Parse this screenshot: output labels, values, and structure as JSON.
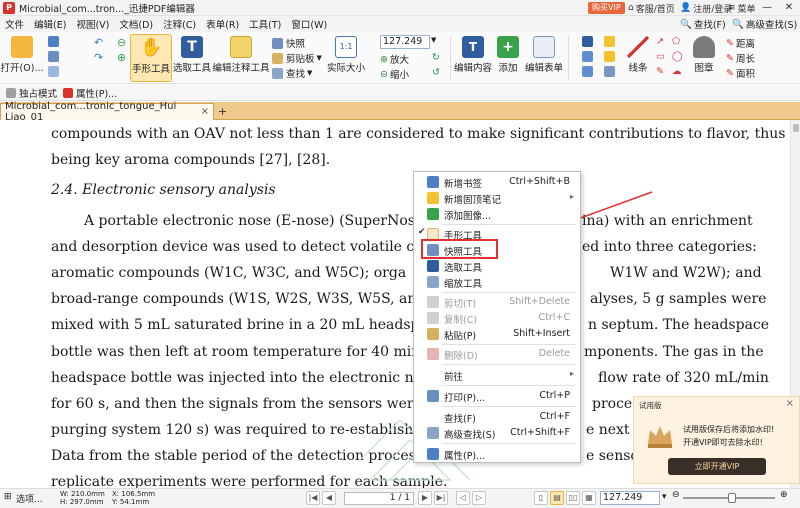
{
  "app": {
    "title": "Microbial_com...tron..._迅捷PDF编辑器",
    "vip_label": "购买VIP",
    "home_label": "客服/首页",
    "login_label": "注册/登录",
    "menu_label": "菜单"
  },
  "menu": {
    "items": [
      "文件",
      "编辑(E)",
      "视图(V)",
      "文档(D)",
      "注释(C)",
      "表单(R)",
      "工具(T)",
      "窗口(W)"
    ],
    "find_label": "查找(F)",
    "advanced_find_label": "高级查找(S)"
  },
  "ribbon": {
    "open": "打开(O)...",
    "hand_tool": "手形工具",
    "select_tool": "选取工具",
    "edit_annot_tool": "编辑注释工具",
    "snapshot": "快照",
    "clipboard": "剪贴板",
    "find": "查找",
    "actual_size": "实际大小",
    "zoom_value": "127.249",
    "zoom_in": "放大",
    "zoom_out": "缩小",
    "edit_content": "编辑内容",
    "add": "添加",
    "edit_form": "编辑表单",
    "line": "线条",
    "stamp": "图章",
    "distance": "距离",
    "perimeter": "周长",
    "area": "面积"
  },
  "toolbar2": {
    "exclusive_mode": "独占模式",
    "properties": "属性(P)..."
  },
  "tab": {
    "name": "Microbial_com...tronic_tongue_Hui Liao_01",
    "close": "×",
    "add": "+"
  },
  "doc": {
    "lines": [
      "compounds with an OAV not less than 1 are considered to make significant contributions to flavor, thus",
      "being key aroma compounds [27], [28].",
      "2.4. Electronic sensory analysis",
      "A portable electronic nose (E-nose) (SuperNose14,",
      "and desorption device was used to detect volatile compo",
      "aromatic compounds (W1C, W3C, and W5C); orga",
      "broad-range compounds (W1S, W2S, W3S, W5S, and W6",
      "mixed with 5 mL saturated brine in a 20 mL headspace",
      "bottle was then left at room temperature for 40 min to e",
      "headspace bottle was injected into the electronic nose via a",
      "for 60 s, and then the signals from the sensors were reco",
      "purging system 120 s) was required to re-establish the ins",
      "Data from the stable period of the detection process (54",
      "replicate experiments were performed for each sample."
    ],
    "right_lines": [
      "ina) with an enrichment",
      "ed into three categories:",
      "W1W and W2W); and",
      "alyses, 5 g samples were",
      "n septum. The headspace",
      "mponents. The gas in the",
      "flow rate of 320 mL/min",
      "proce",
      "e next sa",
      "e sensor"
    ]
  },
  "context_menu": {
    "items": [
      {
        "label": "新增书签",
        "shortcut": "Ctrl+Shift+B",
        "disabled": false
      },
      {
        "label": "新增固顶笔记",
        "shortcut": "",
        "disabled": false,
        "submenu": true
      },
      {
        "label": "添加图像...",
        "shortcut": "",
        "disabled": false
      },
      {
        "label": "手形工具",
        "shortcut": "",
        "disabled": false,
        "checked": true
      },
      {
        "label": "快照工具",
        "shortcut": "",
        "disabled": false
      },
      {
        "label": "选取工具",
        "shortcut": "",
        "disabled": false
      },
      {
        "label": "缩放工具",
        "shortcut": "",
        "disabled": false
      },
      {
        "label": "剪切(T)",
        "shortcut": "Shift+Delete",
        "disabled": true
      },
      {
        "label": "复制(C)",
        "shortcut": "Ctrl+C",
        "disabled": true
      },
      {
        "label": "粘贴(P)",
        "shortcut": "Shift+Insert",
        "disabled": false
      },
      {
        "label": "删除(D)",
        "shortcut": "Delete",
        "disabled": true
      },
      {
        "label": "前往",
        "shortcut": "",
        "disabled": false,
        "submenu": true
      },
      {
        "label": "打印(P)...",
        "shortcut": "Ctrl+P",
        "disabled": false
      },
      {
        "label": "查找(F)",
        "shortcut": "Ctrl+F",
        "disabled": false
      },
      {
        "label": "高级查找(S)",
        "shortcut": "Ctrl+Shift+F",
        "disabled": false
      },
      {
        "label": "属性(P)...",
        "shortcut": "",
        "disabled": false
      }
    ]
  },
  "promo": {
    "title": "试用版",
    "line1": "试用版保存后将添加水印!",
    "line2": "开通VIP即可去除水印!",
    "button": "立即开通VIP",
    "close": "×"
  },
  "status": {
    "select": "选项...",
    "w": "W: 210.0mm",
    "h": "H: 297.0mm",
    "x": "X: 106.5mm",
    "y": "Y: 54.1mm",
    "page": "1 / 1",
    "zoom": "127.249"
  },
  "colors": {
    "accent": "#f0b341",
    "tab_bar": "#f0c98d",
    "highlight": "#e03030",
    "vip": "#e8643a"
  }
}
